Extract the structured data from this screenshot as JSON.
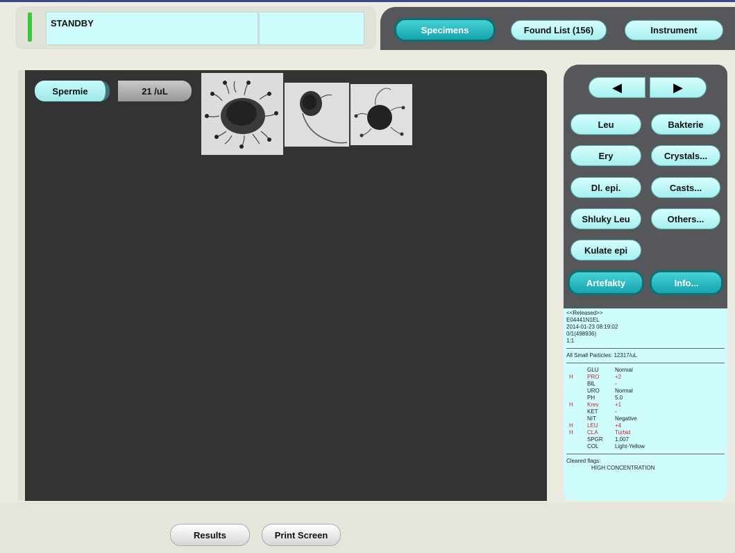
{
  "status": {
    "text": "STANDBY",
    "box2": ""
  },
  "top_nav": {
    "specimens": "Specimens",
    "found_list": "Found List (156)",
    "instrument": "Instrument"
  },
  "category": {
    "name": "Spermie",
    "count": "21 /uL"
  },
  "thumbnails": [
    "sperm-cluster-image-1",
    "sperm-cluster-image-2",
    "sperm-cluster-image-3"
  ],
  "nav_arrows": {
    "prev": "◀",
    "next": "▶"
  },
  "categories": {
    "leu": "Leu",
    "bakterie": "Bakterie",
    "ery": "Ery",
    "crystals": "Crystals...",
    "dl_epi": "Dl. epi.",
    "casts": "Casts...",
    "shluky_leu": "Shluky Leu",
    "others": "Others...",
    "kulate_epi": "Kulate epi",
    "artefakty": "Artefakty",
    "info": "Info..."
  },
  "info": {
    "released": "<<Released>>",
    "sample_id": "E04441N1EL",
    "datetime": "2014-01-23 08:19:02",
    "rack": "0/1(498936)",
    "ratio": "1:1",
    "small_particles": "All Small Particles: 12317/uL",
    "urine": [
      {
        "flag": "",
        "name": "GLU",
        "value": "Normal",
        "high": false
      },
      {
        "flag": "H",
        "name": "PRO",
        "value": "+2",
        "high": true
      },
      {
        "flag": "",
        "name": "BIL",
        "value": "-",
        "high": false
      },
      {
        "flag": "",
        "name": "URO",
        "value": "Normal",
        "high": false
      },
      {
        "flag": "",
        "name": "PH",
        "value": "5.0",
        "high": false
      },
      {
        "flag": "H",
        "name": "Krev",
        "value": "+1",
        "high": true
      },
      {
        "flag": "",
        "name": "KET",
        "value": "-",
        "high": false
      },
      {
        "flag": "",
        "name": "NIT",
        "value": "Negative",
        "high": false
      },
      {
        "flag": "H",
        "name": "LEU",
        "value": "+4",
        "high": true
      },
      {
        "flag": "H",
        "name": "CLA",
        "value": "Turbid",
        "high": true
      },
      {
        "flag": "",
        "name": "SPGR",
        "value": "1.007",
        "high": false
      },
      {
        "flag": "",
        "name": "COL",
        "value": "Light-Yellow",
        "high": false
      }
    ],
    "cleared_label": "Cleared flags:",
    "cleared_value": "HIGH CONCENTRATION"
  },
  "bottom": {
    "results": "Results",
    "print_screen": "Print Screen"
  },
  "colors": {
    "accent": "#15a4ae",
    "panel": "#cffcfc",
    "dark": "#323333",
    "high": "#cc2222"
  }
}
